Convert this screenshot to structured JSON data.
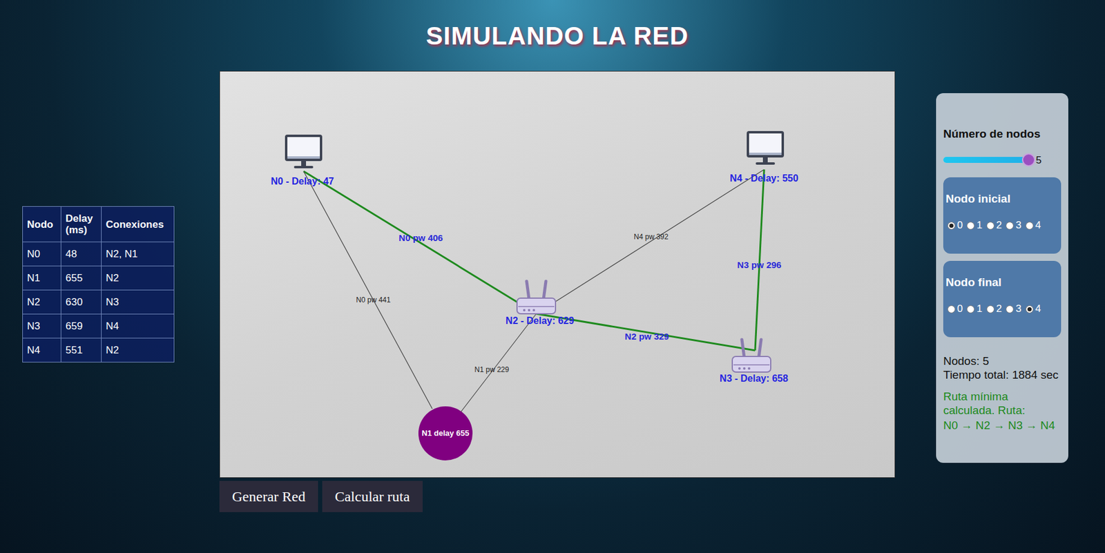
{
  "title": "SIMULANDO LA RED",
  "table": {
    "columns": [
      "Nodo",
      "Delay (ms)",
      "Conexiones"
    ],
    "rows": [
      [
        "N0",
        "48",
        "N2, N1"
      ],
      [
        "N1",
        "655",
        "N2"
      ],
      [
        "N2",
        "630",
        "N3"
      ],
      [
        "N3",
        "659",
        "N4"
      ],
      [
        "N4",
        "551",
        "N2"
      ]
    ]
  },
  "network": {
    "nodes": [
      {
        "label": "N0 - Delay: 47",
        "kind": "pc"
      },
      {
        "label": "N1 delay 655",
        "kind": "circle"
      },
      {
        "label": "N2 - Delay: 629",
        "kind": "router"
      },
      {
        "label": "N3 - Delay: 658",
        "kind": "router"
      },
      {
        "label": "N4 - Delay: 550",
        "kind": "pc"
      }
    ],
    "edges": [
      {
        "label": "N0 pw 406",
        "on_route": true
      },
      {
        "label": "N0 pw 441",
        "on_route": false
      },
      {
        "label": "N4 pw 392",
        "on_route": false
      },
      {
        "label": "N3 pw 296",
        "on_route": true
      },
      {
        "label": "N2 pw 329",
        "on_route": true
      },
      {
        "label": "N1 pw 229",
        "on_route": false
      }
    ]
  },
  "controls": {
    "node_count": {
      "label": "Número de nodos",
      "value": "5",
      "level": 1
    },
    "start": {
      "label": "Nodo inicial",
      "options": [
        {
          "label": "0",
          "selected": true
        },
        {
          "label": "1",
          "selected": false
        },
        {
          "label": "2",
          "selected": false
        },
        {
          "label": "3",
          "selected": false
        },
        {
          "label": "4",
          "selected": false
        }
      ]
    },
    "end": {
      "label": "Nodo final",
      "options": [
        {
          "label": "0",
          "selected": false
        },
        {
          "label": "1",
          "selected": false
        },
        {
          "label": "2",
          "selected": false
        },
        {
          "label": "3",
          "selected": false
        },
        {
          "label": "4",
          "selected": true
        }
      ]
    }
  },
  "status": {
    "nodes": "Nodos: 5",
    "total_time": "Tiempo total: 1884 sec",
    "route_message": "Ruta mínima calculada. Ruta:",
    "route": "N0 → N2 → N3 → N4"
  },
  "buttons": [
    "Generar Red",
    "Calcular ruta"
  ]
}
